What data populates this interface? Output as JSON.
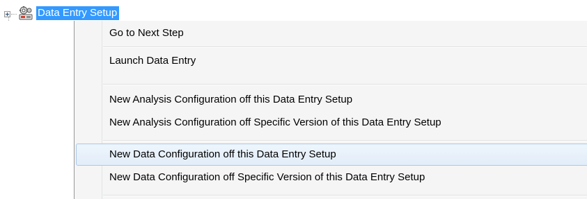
{
  "tree": {
    "node_label": "Data Entry Setup",
    "node_icon": "data-entry-setup-icon",
    "expander": "plus"
  },
  "menu": {
    "items": [
      {
        "label": "Go to Next Step"
      },
      {
        "label": "Launch Data Entry"
      },
      {
        "label": "New Analysis Configuration off this Data Entry Setup"
      },
      {
        "label": "New Analysis Configuration off Specific Version of this Data Entry Setup"
      },
      {
        "label": "New Data Configuration off this Data Entry Setup"
      },
      {
        "label": "New Data Configuration off Specific Version of this Data Entry Setup"
      }
    ],
    "highlighted_index": 4
  },
  "colors": {
    "selection": "#3399ff",
    "menu_background": "#f5f5f5",
    "hover_border": "#a8c8ea"
  }
}
